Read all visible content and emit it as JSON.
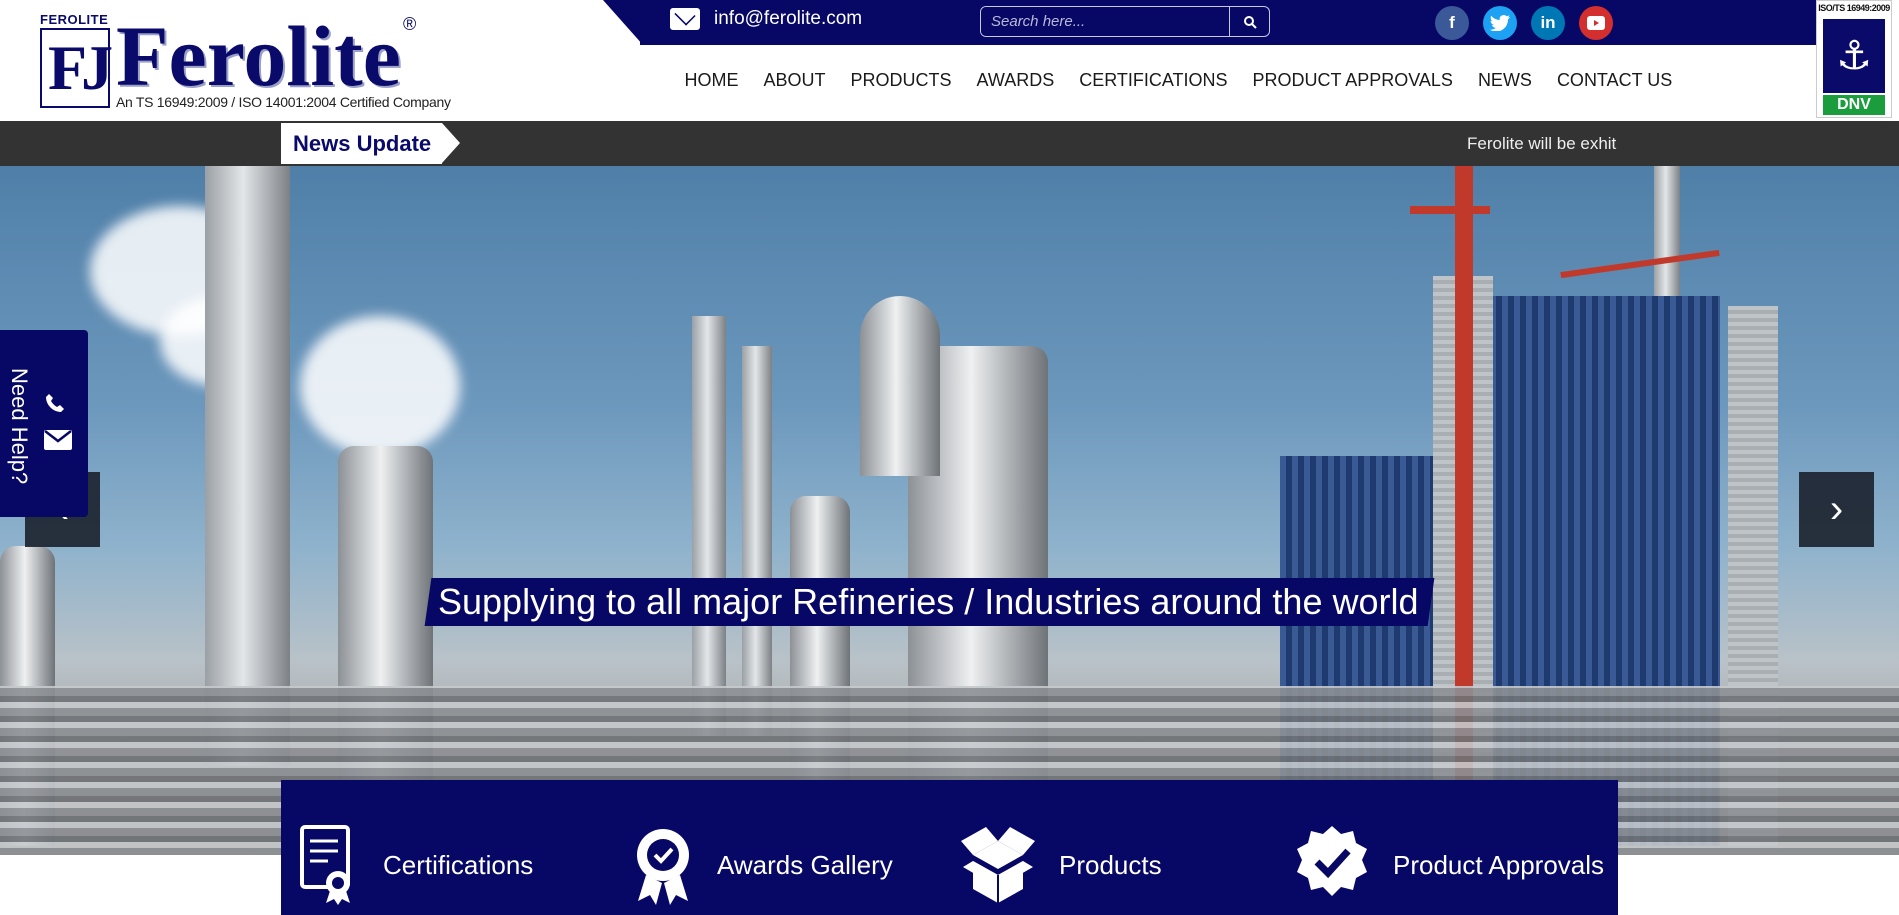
{
  "header": {
    "logo_small": "FEROLITE",
    "logo_mark": "FJ",
    "logo_word": "Ferolite",
    "logo_reg": "®",
    "logo_tagline": "An TS 16949:2009 / ISO 14001:2004 Certified Company",
    "email": "info@ferolite.com",
    "search_placeholder": "Search here...",
    "social": [
      "facebook-icon",
      "twitter-icon",
      "linkedin-icon",
      "youtube-icon"
    ],
    "nav": [
      "HOME",
      "ABOUT",
      "PRODUCTS",
      "AWARDS",
      "CERTIFICATIONS",
      "PRODUCT APPROVALS",
      "NEWS",
      "CONTACT US"
    ],
    "cert_badge_top": "ISO/TS 16949:2009",
    "cert_badge_bottom": "DNV"
  },
  "news": {
    "label": "News Update",
    "ticker": "Ferolite will be exhit"
  },
  "hero": {
    "caption": "Supplying to all major Refineries / Industries around the world",
    "prev": "‹",
    "next": "›"
  },
  "need_help": {
    "label": "Need Help?"
  },
  "quick_links": [
    {
      "label": "Certifications",
      "icon": "certificate-icon"
    },
    {
      "label": "Awards Gallery",
      "icon": "award-ribbon-icon"
    },
    {
      "label": "Products",
      "icon": "open-box-icon"
    },
    {
      "label": "Product Approvals",
      "icon": "approval-check-icon"
    }
  ],
  "colors": {
    "brand": "#070766",
    "newsbar": "#333333"
  }
}
